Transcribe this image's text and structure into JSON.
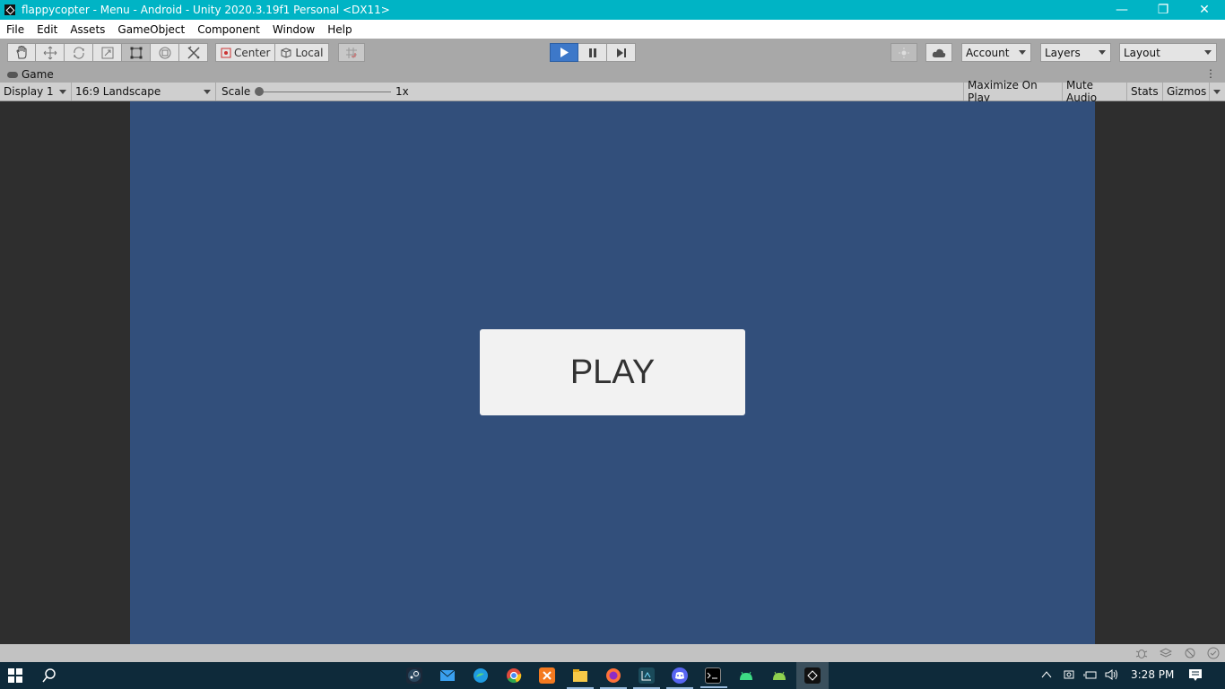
{
  "window": {
    "title": "flappycopter - Menu - Android - Unity 2020.3.19f1 Personal <DX11>",
    "controls": {
      "minimize": "—",
      "restore": "❐",
      "close": "✕"
    }
  },
  "menu": {
    "items": [
      "File",
      "Edit",
      "Assets",
      "GameObject",
      "Component",
      "Window",
      "Help"
    ]
  },
  "toolbar": {
    "tools": [
      "hand-tool-icon",
      "move-tool-icon",
      "rotate-tool-icon",
      "scale-tool-icon",
      "rect-tool-icon",
      "transform-tool-icon",
      "custom-tool-icon"
    ],
    "pivot_label": "Center",
    "space_label": "Local",
    "account_label": "Account",
    "layers_label": "Layers",
    "layout_label": "Layout"
  },
  "game_tab": {
    "label": "Game"
  },
  "game_bar": {
    "display": "Display 1",
    "aspect": "16:9 Landscape",
    "scale_label": "Scale",
    "scale_value": "1x",
    "maximize_on_play": "Maximize On Play",
    "mute_audio": "Mute Audio",
    "stats": "Stats",
    "gizmos": "Gizmos"
  },
  "game_view": {
    "play_button_label": "PLAY",
    "canvas_color": "#324f7b",
    "button_color": "#f2f2f2"
  },
  "taskbar": {
    "time": "3:28 PM"
  },
  "colors": {
    "title_bar": "#00b4c5",
    "play_active": "#3d78c9"
  }
}
